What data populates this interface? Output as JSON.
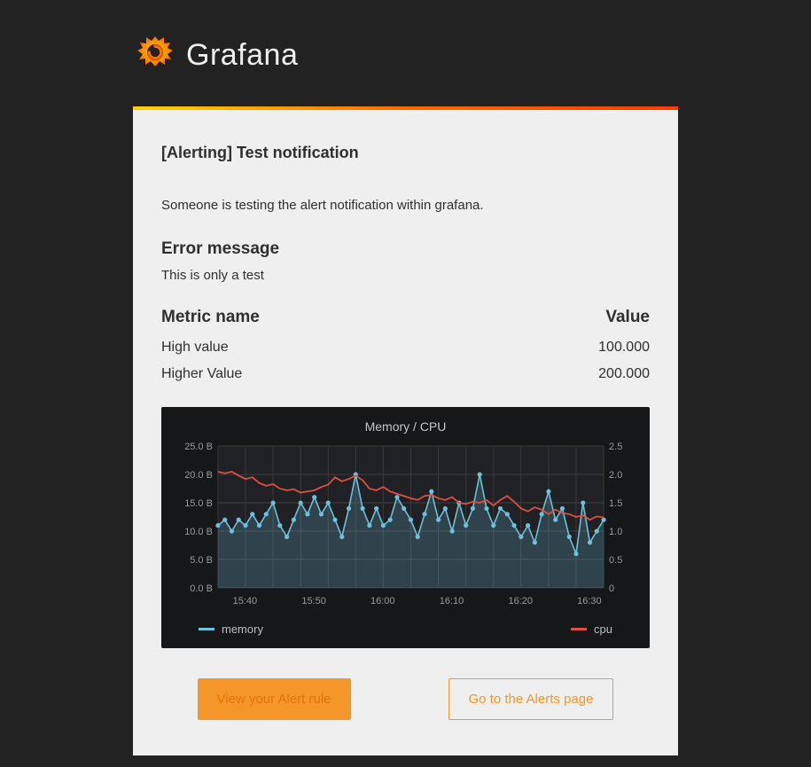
{
  "brand": "Grafana",
  "alert": {
    "title": "[Alerting] Test notification",
    "description": "Someone is testing the alert notification within grafana.",
    "error_heading": "Error message",
    "error_text": "This is only a test"
  },
  "metrics": {
    "col_metric": "Metric name",
    "col_value": "Value",
    "rows": [
      {
        "name": "High value",
        "value": "100.000"
      },
      {
        "name": "Higher Value",
        "value": "200.000"
      }
    ]
  },
  "chart_data": {
    "type": "line",
    "title": "Memory / CPU",
    "x": [
      "15:40",
      "15:50",
      "16:00",
      "16:10",
      "16:20",
      "16:30"
    ],
    "y_left": {
      "label": "",
      "unit": "B",
      "ticks": [
        0.0,
        5.0,
        10.0,
        15.0,
        20.0,
        25.0
      ],
      "tick_suffix": " B"
    },
    "y_right": {
      "label": "",
      "ticks": [
        0,
        0.5,
        1.0,
        1.5,
        2.0,
        2.5
      ]
    },
    "series": [
      {
        "name": "memory",
        "axis": "left",
        "color": "#6ec0db",
        "style": "area-points",
        "values": [
          11,
          12,
          10,
          12,
          11,
          13,
          11,
          13,
          15,
          11,
          9,
          12,
          15,
          13,
          16,
          13,
          15,
          12,
          9,
          14,
          20,
          14,
          11,
          14,
          11,
          12,
          16,
          14,
          12,
          9,
          13,
          17,
          12,
          14,
          10,
          15,
          11,
          14,
          20,
          14,
          11,
          14,
          13,
          11,
          9,
          11,
          8,
          13,
          17,
          12,
          14,
          9,
          6,
          15,
          8,
          10,
          12
        ]
      },
      {
        "name": "cpu",
        "axis": "right",
        "color": "#e24d42",
        "style": "line",
        "values": [
          2.05,
          2.02,
          2.05,
          1.98,
          1.92,
          1.95,
          1.85,
          1.8,
          1.83,
          1.75,
          1.72,
          1.74,
          1.68,
          1.7,
          1.72,
          1.78,
          1.82,
          1.95,
          1.88,
          1.92,
          1.98,
          1.9,
          1.75,
          1.72,
          1.78,
          1.7,
          1.66,
          1.62,
          1.58,
          1.55,
          1.62,
          1.64,
          1.58,
          1.55,
          1.6,
          1.5,
          1.48,
          1.52,
          1.5,
          1.55,
          1.45,
          1.55,
          1.62,
          1.52,
          1.4,
          1.35,
          1.42,
          1.38,
          1.3,
          1.38,
          1.32,
          1.3,
          1.25,
          1.28,
          1.2,
          1.26,
          1.24
        ]
      }
    ]
  },
  "legend": {
    "memory": "memory",
    "cpu": "cpu"
  },
  "buttons": {
    "primary": "View your Alert rule",
    "secondary": "Go to the Alerts page"
  }
}
